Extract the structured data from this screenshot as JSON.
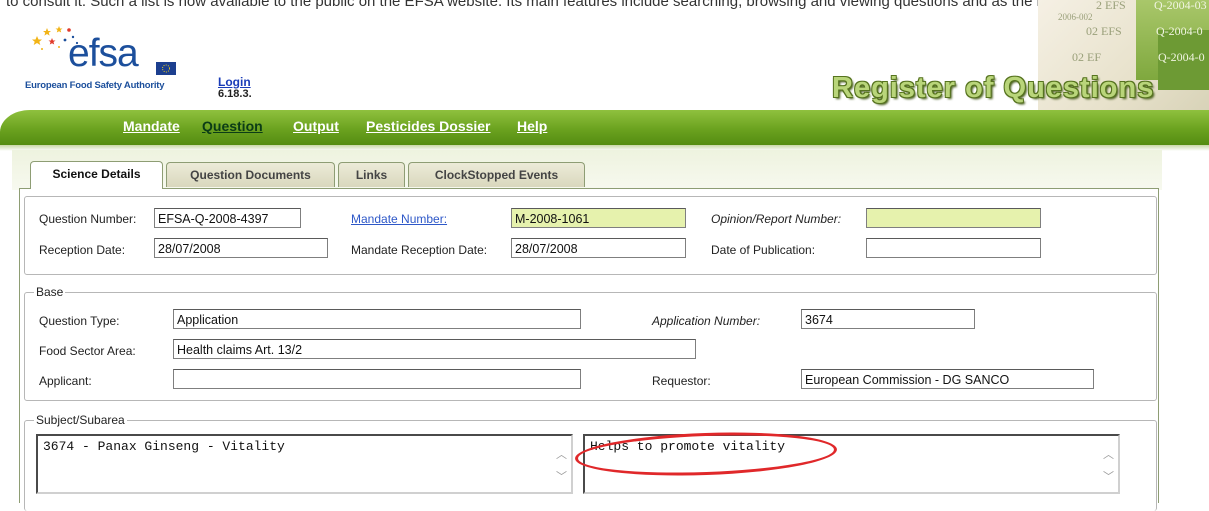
{
  "header": {
    "top_text": "to consult it. Such a list is now available to the public on the EFSA website. Its main features include searching, browsing and viewing questions and as the result of this project.",
    "logo_word": "efsa",
    "logo_tagline": "European Food Safety Authority",
    "login_label": "Login",
    "version": "6.18.3.",
    "collage_fragments": [
      "2 EFS",
      "Q-2004-03",
      "2006-002",
      "02 EFS",
      "Q-2004-0",
      "02 EF",
      "Q-2004-0"
    ],
    "app_title": "Register of Questions"
  },
  "menu": {
    "items": [
      {
        "label": "Mandate",
        "active": false
      },
      {
        "label": "Question",
        "active": true
      },
      {
        "label": "Output",
        "active": false
      },
      {
        "label": "Pesticides Dossier",
        "active": false
      },
      {
        "label": "Help",
        "active": false
      }
    ]
  },
  "tabs": [
    {
      "label": "Science Details",
      "active": true
    },
    {
      "label": "Question Documents",
      "active": false
    },
    {
      "label": "Links",
      "active": false
    },
    {
      "label": "ClockStopped Events",
      "active": false
    }
  ],
  "details": {
    "question_number_label": "Question Number:",
    "question_number_value": "EFSA-Q-2008-4397",
    "mandate_number_label": "Mandate Number:",
    "mandate_number_value": "M-2008-1061",
    "opinion_label": "Opinion/Report Number:",
    "opinion_value": "",
    "reception_date_label": "Reception Date:",
    "reception_date_value": "28/07/2008",
    "mandate_reception_label": "Mandate Reception Date:",
    "mandate_reception_value": "28/07/2008",
    "publication_label": "Date of Publication:",
    "publication_value": ""
  },
  "base": {
    "legend": "Base",
    "question_type_label": "Question Type:",
    "question_type_value": "Application",
    "application_number_label": "Application Number:",
    "application_number_value": "3674",
    "food_sector_label": "Food Sector Area:",
    "food_sector_value": "Health claims Art. 13/2",
    "applicant_label": "Applicant:",
    "applicant_value": "",
    "requestor_label": "Requestor:",
    "requestor_value": "European Commission - DG SANCO"
  },
  "subject": {
    "legend": "Subject/Subarea",
    "subject_value": "3674 - Panax Ginseng - Vitality",
    "subarea_value": "Helps to promote vitality"
  },
  "colors": {
    "menu_green": "#6ba21f",
    "active_menu": "#0b3c16",
    "highlight_field": "#e6f2ad",
    "annotation_red": "#e0282a",
    "link_blue": "#2e58c8"
  }
}
